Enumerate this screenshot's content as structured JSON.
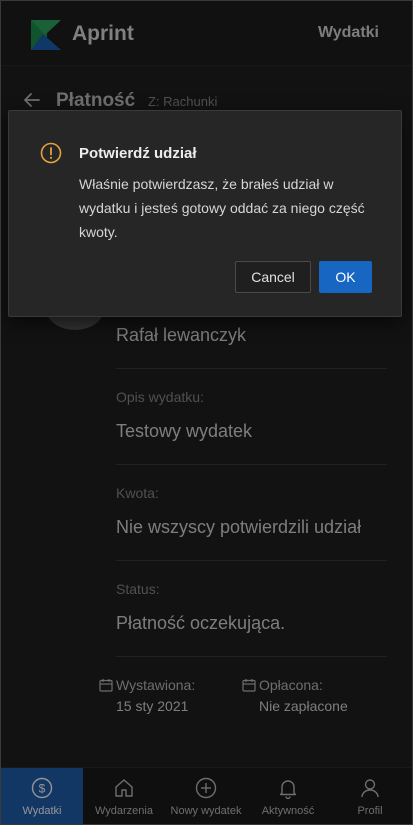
{
  "header": {
    "brand": "Aprint",
    "nav_link": "Wydatki"
  },
  "page": {
    "title": "Płatność",
    "subtitle": "Z: Rachunki"
  },
  "details": {
    "payer": "Rafał lewanczyk",
    "description_label": "Opis wydatku:",
    "description_value": "Testowy wydatek",
    "amount_label": "Kwota:",
    "amount_value": "Nie wszyscy potwierdzili udział",
    "status_label": "Status:",
    "status_value": "Płatność oczekująca.",
    "issued_label": "Wystawiona:",
    "issued_value": "15 sty 2021",
    "paid_label": "Opłacona:",
    "paid_value": "Nie zapłacone"
  },
  "dialog": {
    "title": "Potwierdź udział",
    "message": "Właśnie potwierdzasz, że brałeś udział w wydatku i jesteś gotowy oddać za niego część kwoty.",
    "cancel_label": "Cancel",
    "ok_label": "OK",
    "icon": "warning-icon",
    "icon_color": "#e6a23c"
  },
  "bottom_nav": {
    "items": [
      {
        "label": "Wydatki",
        "icon": "dollar-circle-icon",
        "active": true
      },
      {
        "label": "Wydarzenia",
        "icon": "home-icon",
        "active": false
      },
      {
        "label": "Nowy wydatek",
        "icon": "plus-circle-icon",
        "active": false
      },
      {
        "label": "Aktywność",
        "icon": "bell-icon",
        "active": false
      },
      {
        "label": "Profil",
        "icon": "user-icon",
        "active": false
      }
    ]
  },
  "colors": {
    "accent": "#1766c2",
    "nav_active": "#1f5fae",
    "background": "#1f1f1f"
  }
}
